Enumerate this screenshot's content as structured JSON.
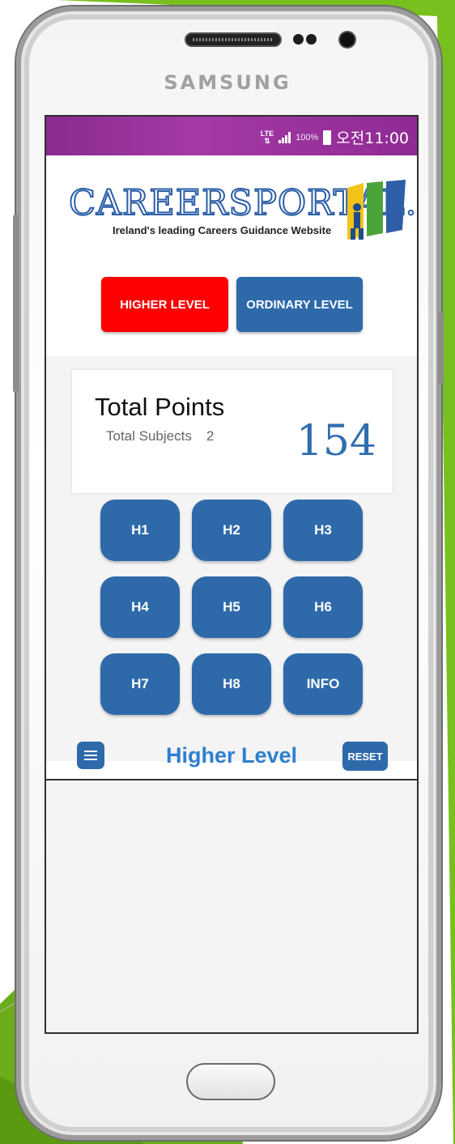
{
  "device": {
    "brand": "SAMSUNG"
  },
  "status_bar": {
    "network": "LTE",
    "battery_percent": "100%",
    "time": "오전11:00"
  },
  "logo": {
    "text": "CAREERSPORTAL.ie",
    "tagline": "Ireland's leading Careers Guidance Website"
  },
  "level_toggle": {
    "higher_label": "HIGHER LEVEL",
    "ordinary_label": "ORDINARY LEVEL",
    "higher_color": "#ff0000",
    "ordinary_color": "#2e6aaa"
  },
  "points": {
    "title": "Total Points",
    "subjects_label": "Total Subjects",
    "subjects_count": "2",
    "total": "154"
  },
  "grades": [
    "H1",
    "H2",
    "H3",
    "H4",
    "H5",
    "H6",
    "H7",
    "H8",
    "INFO"
  ],
  "bottom_bar": {
    "current_level": "Higher Level",
    "reset_label": "RESET"
  },
  "colors": {
    "accent_blue": "#2e6aaa",
    "status_purple": "#8a2a8f",
    "background_green": "#78c01e"
  }
}
